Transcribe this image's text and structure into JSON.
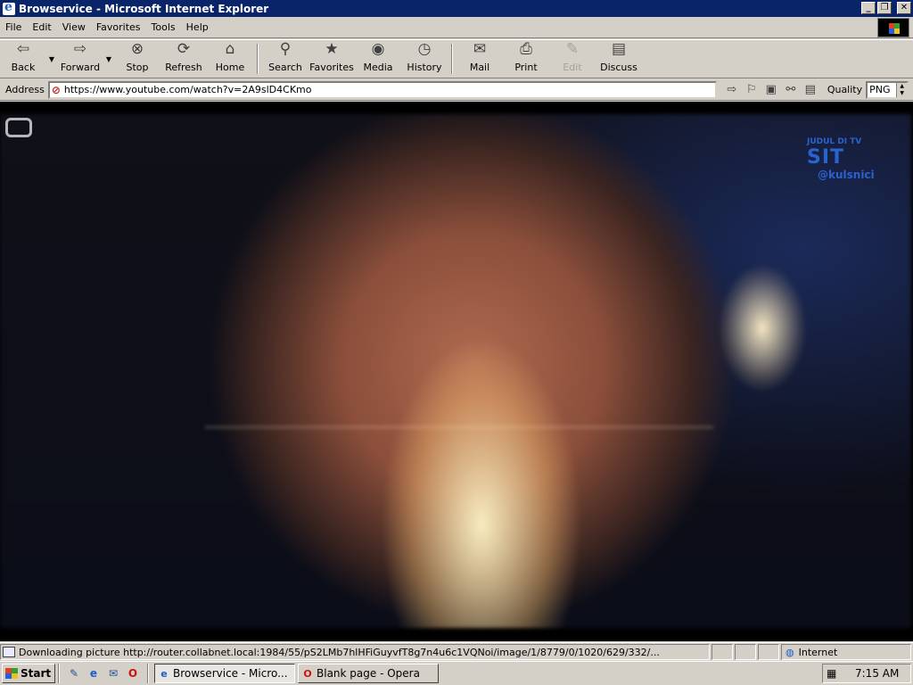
{
  "window": {
    "title": "Browservice - Microsoft Internet Explorer",
    "controls": [
      "_",
      "❐",
      "✕"
    ]
  },
  "menu": {
    "items": [
      "File",
      "Edit",
      "View",
      "Favorites",
      "Tools",
      "Help"
    ]
  },
  "toolbar": {
    "buttons": [
      {
        "label": "Back",
        "icon": "back-arrow-icon",
        "glyph": "⇦"
      },
      {
        "label": "Forward",
        "icon": "forward-arrow-icon",
        "glyph": "⇨"
      },
      {
        "label": "Stop",
        "icon": "stop-icon",
        "glyph": "⊗"
      },
      {
        "label": "Refresh",
        "icon": "refresh-icon",
        "glyph": "⟳"
      },
      {
        "label": "Home",
        "icon": "home-icon",
        "glyph": "⌂"
      },
      {
        "label": "Search",
        "icon": "search-icon",
        "glyph": "⚲"
      },
      {
        "label": "Favorites",
        "icon": "favorites-icon",
        "glyph": "★"
      },
      {
        "label": "Media",
        "icon": "media-icon",
        "glyph": "◉"
      },
      {
        "label": "History",
        "icon": "history-icon",
        "glyph": "◷"
      },
      {
        "label": "Mail",
        "icon": "mail-icon",
        "glyph": "✉"
      },
      {
        "label": "Print",
        "icon": "print-icon",
        "glyph": "⎙"
      },
      {
        "label": "Edit",
        "icon": "edit-icon",
        "glyph": "✎"
      },
      {
        "label": "Discuss",
        "icon": "discuss-icon",
        "glyph": "▤"
      }
    ]
  },
  "address": {
    "label": "Address",
    "url": "https://www.youtube.com/watch?v=2A9slD4CKmo",
    "quality_label": "Quality",
    "quality_value": "PNG"
  },
  "video": {
    "watermark_top": "JUDUL DI TV",
    "watermark_main": "SIT",
    "watermark_handle": "@kulsnici"
  },
  "status": {
    "text": "Downloading picture http://router.collabnet.local:1984/55/pS2LMb7hlHFiGuyvfT8g7n4u6c1VQNoi/image/1/8779/0/1020/629/332/...",
    "zone": "Internet"
  },
  "taskbar": {
    "start": "Start",
    "tasks": [
      {
        "label": "Browservice - Micro...",
        "active": true
      },
      {
        "label": "Blank page - Opera",
        "active": false
      }
    ],
    "clock": "7:15 AM"
  }
}
